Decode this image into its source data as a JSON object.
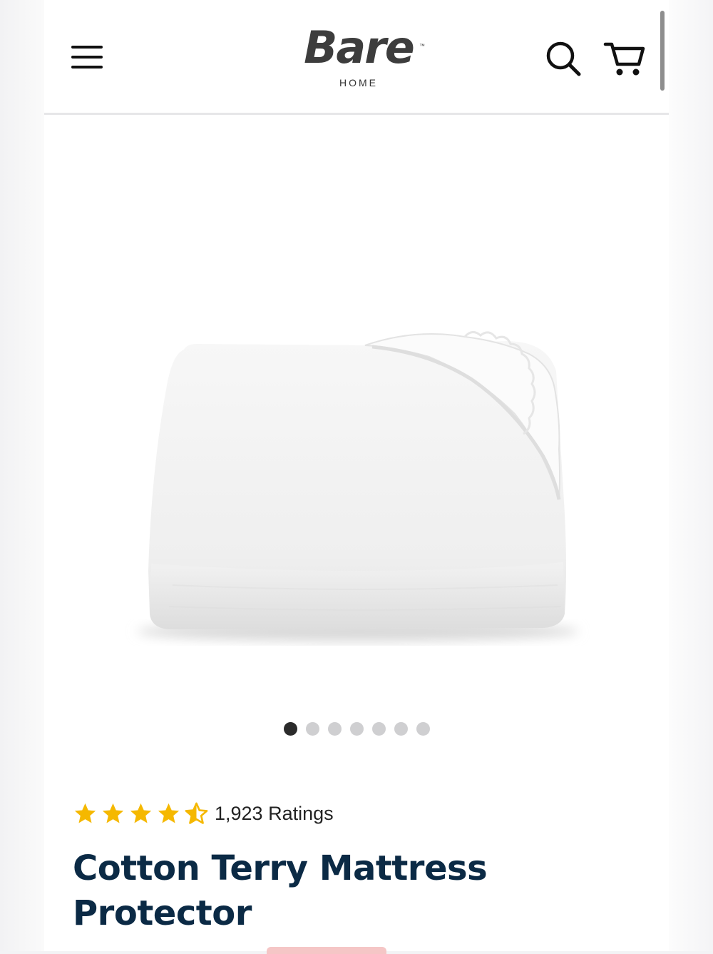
{
  "brand": {
    "name": "Bare",
    "sub": "HOME",
    "tm": "™"
  },
  "header": {
    "menu_icon": "hamburger-menu-icon",
    "search_icon": "search-icon",
    "cart_icon": "cart-icon"
  },
  "gallery": {
    "image_alt": "Cotton Terry Mattress Protector folded",
    "slide_count": 7,
    "active_slide": 1
  },
  "rating": {
    "stars": 4.5,
    "count_label": "1,923 Ratings",
    "star_color": "#f5b800"
  },
  "product": {
    "title_line1": "Cotton Terry Mattress",
    "title_line2": "Protector",
    "title_color": "#0b2a45"
  }
}
